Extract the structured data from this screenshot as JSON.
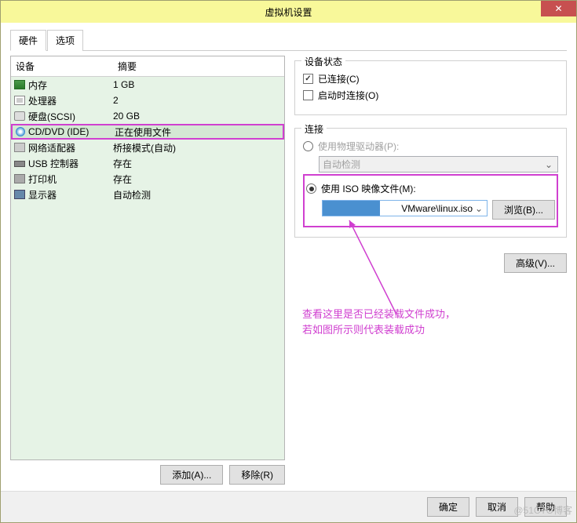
{
  "window": {
    "title": "虚拟机设置",
    "close": "✕"
  },
  "tabs": {
    "hardware": "硬件",
    "options": "选项"
  },
  "columns": {
    "device": "设备",
    "summary": "摘要"
  },
  "devices": [
    {
      "icon": "icon-mem",
      "name": "内存",
      "summary": "1 GB"
    },
    {
      "icon": "icon-cpu",
      "name": "处理器",
      "summary": "2"
    },
    {
      "icon": "icon-disk",
      "name": "硬盘(SCSI)",
      "summary": "20 GB"
    },
    {
      "icon": "icon-cd",
      "name": "CD/DVD (IDE)",
      "summary": "正在使用文件",
      "selected": true
    },
    {
      "icon": "icon-net",
      "name": "网络适配器",
      "summary": "桥接模式(自动)"
    },
    {
      "icon": "icon-usb",
      "name": "USB 控制器",
      "summary": "存在"
    },
    {
      "icon": "icon-printer",
      "name": "打印机",
      "summary": "存在"
    },
    {
      "icon": "icon-display",
      "name": "显示器",
      "summary": "自动检测"
    }
  ],
  "leftButtons": {
    "add": "添加(A)...",
    "remove": "移除(R)"
  },
  "status": {
    "title": "设备状态",
    "connected": "已连接(C)",
    "connectAtPower": "启动时连接(O)"
  },
  "connection": {
    "title": "连接",
    "usePhysical": "使用物理驱动器(P):",
    "autoDetect": "自动检测",
    "useIso": "使用 ISO 映像文件(M):",
    "isoPath": "VMware\\linux.iso",
    "browse": "浏览(B)..."
  },
  "advanced": "高级(V)...",
  "annotation": {
    "line1": "查看这里是否已经装载文件成功，",
    "line2": "若如图所示则代表装载成功"
  },
  "footer": {
    "ok": "确定",
    "cancel": "取消",
    "help": "帮助"
  },
  "watermark": "@51CTO博客"
}
